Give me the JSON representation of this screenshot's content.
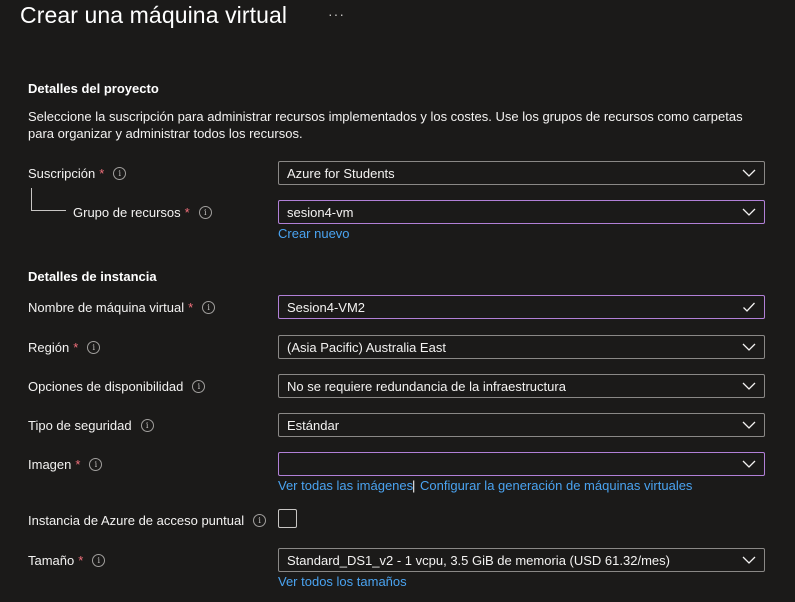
{
  "header": {
    "title": "Crear una máquina virtual",
    "more": "···"
  },
  "project": {
    "heading": "Detalles del proyecto",
    "description": "Seleccione la suscripción para administrar recursos implementados y los costes. Use los grupos de recursos como carpetas para organizar y administrar todos los recursos.",
    "subscription_label": "Suscripción",
    "subscription_value": "Azure for Students",
    "resource_group_label": "Grupo de recursos",
    "resource_group_value": "sesion4-vm",
    "create_new": "Crear nuevo"
  },
  "instance": {
    "heading": "Detalles de instancia",
    "vm_name_label": "Nombre de máquina virtual",
    "vm_name_value": "Sesion4-VM2",
    "region_label": "Región",
    "region_value": "(Asia Pacific) Australia East",
    "availability_label": "Opciones de disponibilidad",
    "availability_value": "No se requiere redundancia de la infraestructura",
    "security_label": "Tipo de seguridad",
    "security_value": "Estándar",
    "image_label": "Imagen",
    "image_value": "",
    "see_all_images": "Ver todas las imágenes",
    "separator": "|",
    "configure_generation": "Configurar la generación de máquinas virtuales",
    "spot_label": "Instancia de Azure de acceso puntual",
    "spot_checked": false,
    "size_label": "Tamaño",
    "size_value": "Standard_DS1_v2 - 1 vcpu, 3.5 GiB de memoria (USD 61.32/mes)",
    "see_all_sizes": "Ver todos los tamaños"
  },
  "required_mark": "*",
  "info_glyph": "i",
  "colors": {
    "background": "#1b1a19",
    "link": "#4aa3f0",
    "required": "#f1707b",
    "focus_border": "#b180d7"
  }
}
